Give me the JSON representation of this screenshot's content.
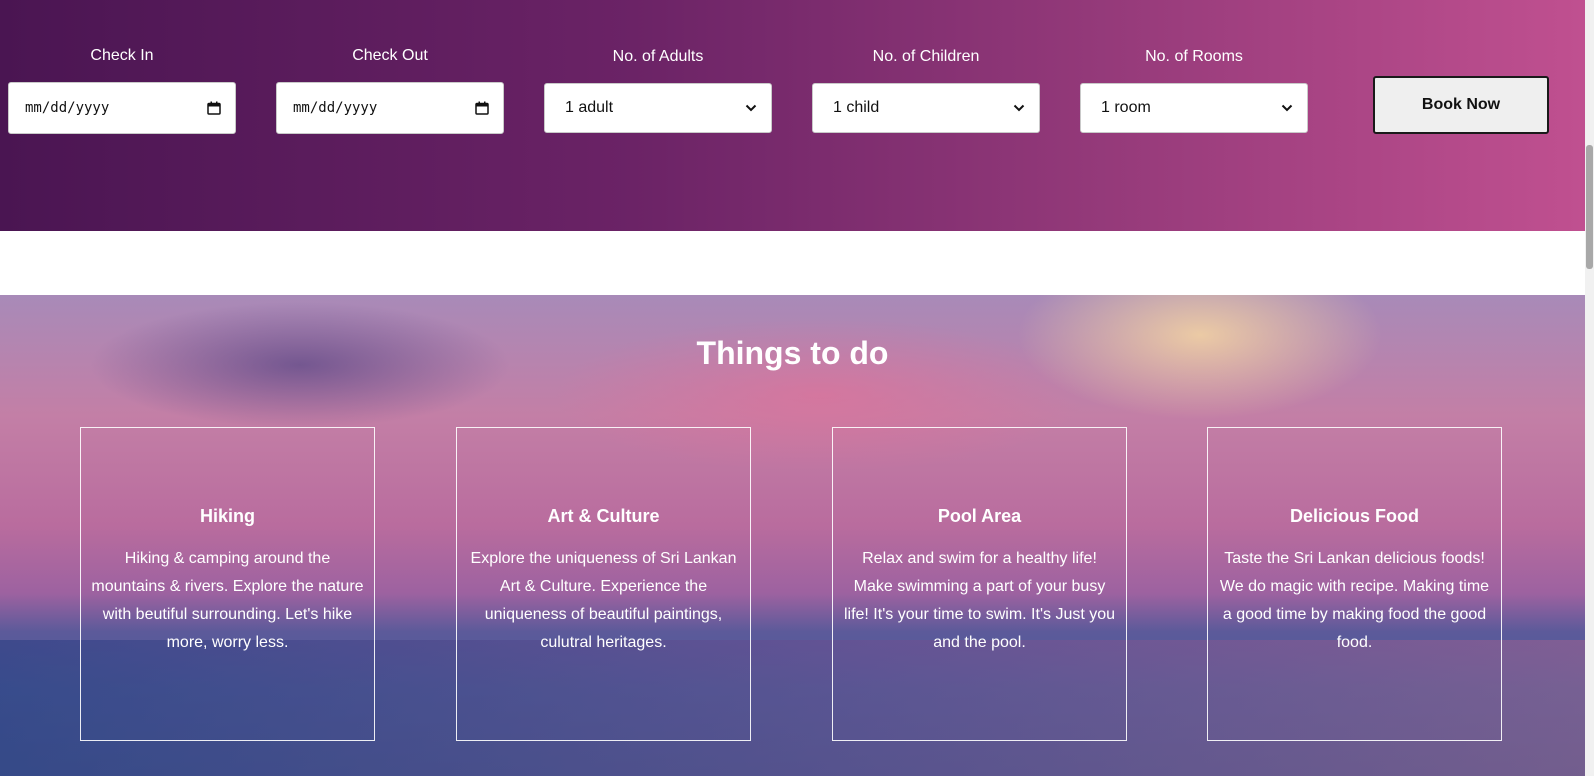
{
  "booking": {
    "check_in": {
      "label": "Check In",
      "placeholder": "mm/dd/yyyy"
    },
    "check_out": {
      "label": "Check Out",
      "placeholder": "mm/dd/yyyy"
    },
    "adults": {
      "label": "No. of Adults",
      "selected": "1 adult"
    },
    "children": {
      "label": "No. of Children",
      "selected": "1 child"
    },
    "rooms": {
      "label": "No. of Rooms",
      "selected": "1 room"
    },
    "book_label": "Book Now",
    "gradient_colors": [
      "#4a1552",
      "#6b2366",
      "#953a7a",
      "#c05090"
    ]
  },
  "things_to_do": {
    "title": "Things to do",
    "cards": [
      {
        "title": "Hiking",
        "text": "Hiking & camping around the mountains & rivers. Explore the nature with beutiful surrounding. Let's hike more, worry less."
      },
      {
        "title": "Art & Culture",
        "text": "Explore the uniqueness of Sri Lankan Art & Culture. Experience the uniqueness of beautiful paintings, culutral heritages."
      },
      {
        "title": "Pool Area",
        "text": "Relax and swim for a healthy life! Make swimming a part of your busy life! It's your time to swim. It's Just you and the pool."
      },
      {
        "title": "Delicious Food",
        "text": "Taste the Sri Lankan delicious foods! We do magic with recipe. Making time a good time by making food the good food."
      }
    ]
  }
}
